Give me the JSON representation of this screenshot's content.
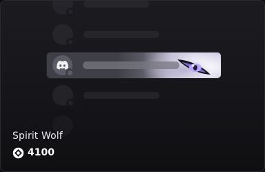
{
  "item": {
    "name": "Spirit Wolf",
    "price": "4100"
  },
  "icons": {
    "currency": "orb-icon",
    "service": "discord-icon"
  },
  "colors": {
    "card_background": "#16161a",
    "eye_accent": "#b8a6ff"
  }
}
